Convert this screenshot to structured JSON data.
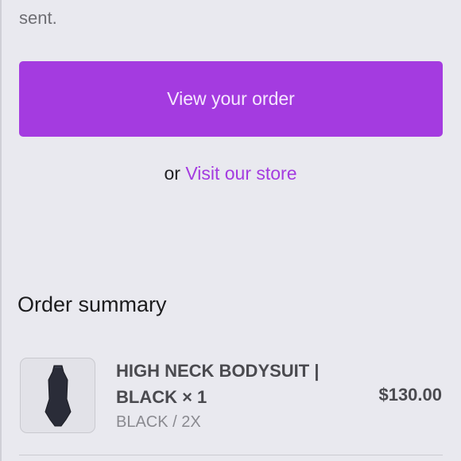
{
  "intro": {
    "sent_text": "sent."
  },
  "actions": {
    "view_order_label": "View your order",
    "or_text": "or",
    "visit_store_label": "Visit our store"
  },
  "summary": {
    "heading": "Order summary",
    "items": [
      {
        "title": "HIGH NECK BODYSUIT | BLACK × 1",
        "variant": "BLACK / 2X",
        "price": "$130.00",
        "image_icon": "bodysuit-product-image"
      }
    ]
  },
  "colors": {
    "accent": "#a43be0",
    "background": "#e9e9ef",
    "text_muted": "#8a8a90"
  }
}
